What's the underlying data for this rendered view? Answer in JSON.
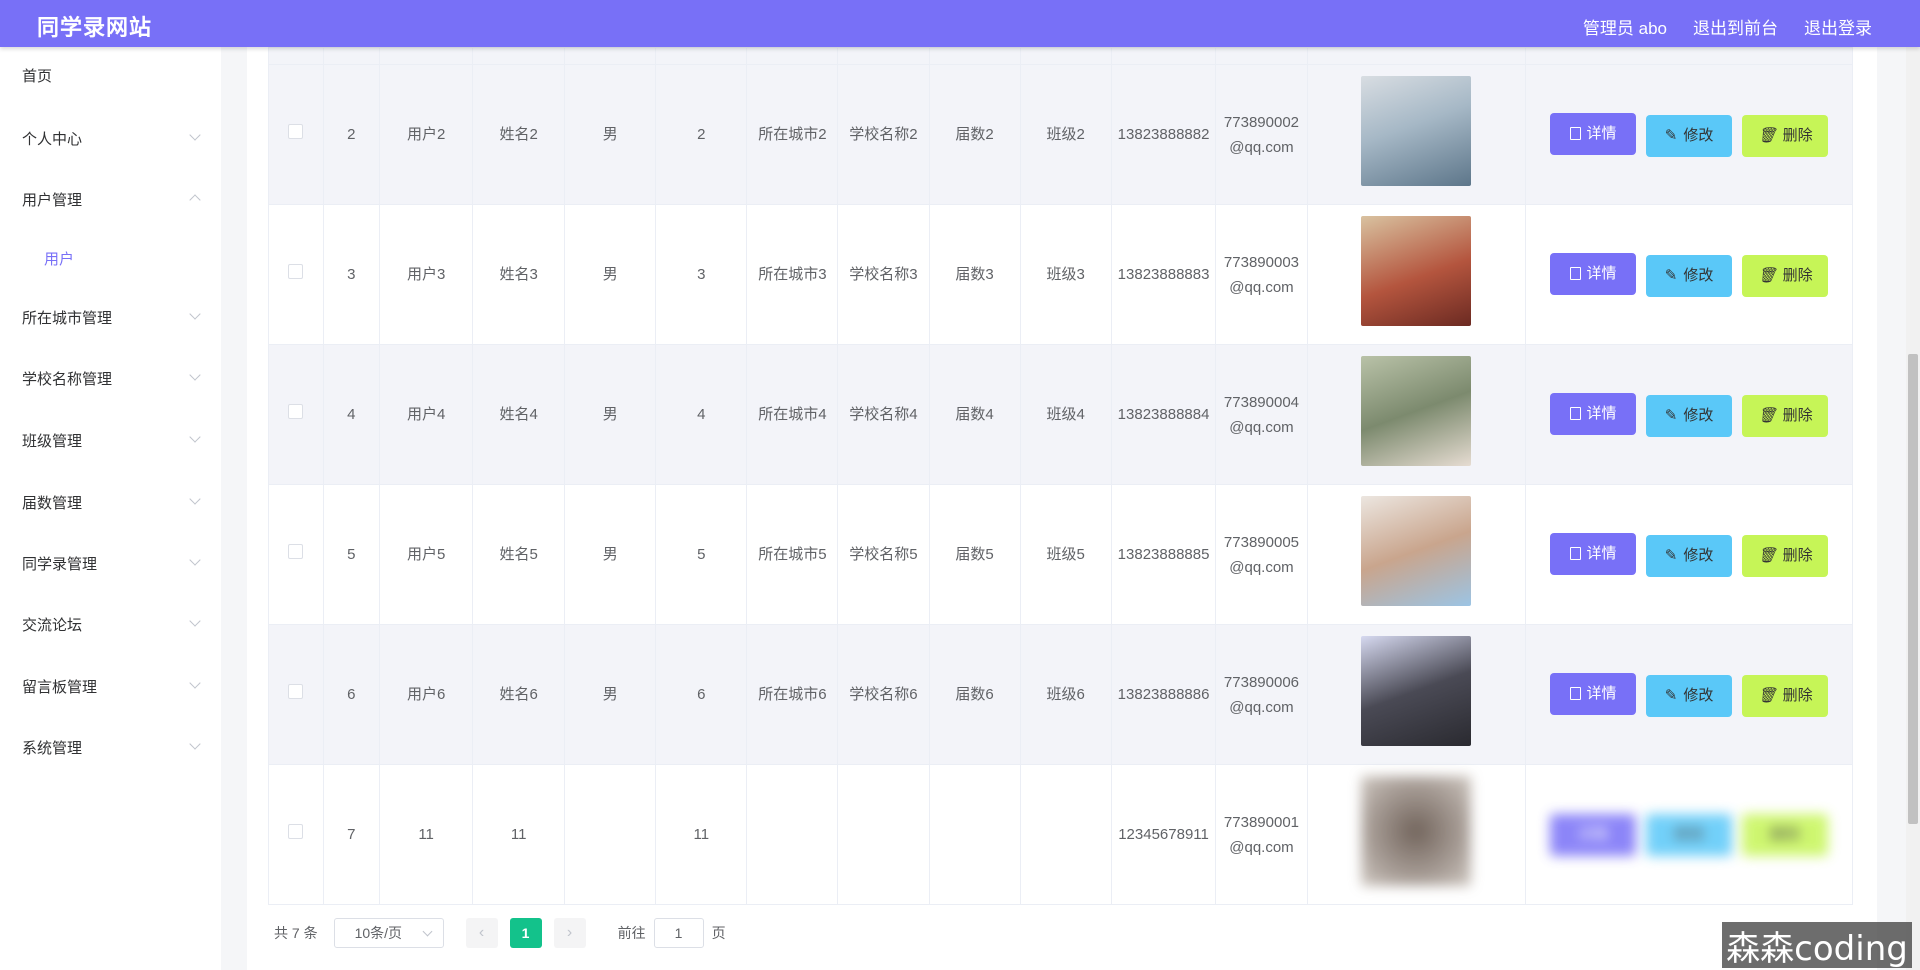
{
  "app": {
    "title": "同学录网站"
  },
  "header": {
    "admin": "管理员 abo",
    "to_front": "退出到前台",
    "logout": "退出登录"
  },
  "sidebar": {
    "items": [
      {
        "label": "首页",
        "arrow": ""
      },
      {
        "label": "个人中心",
        "arrow": "down"
      },
      {
        "label": "用户管理",
        "arrow": "up"
      },
      {
        "label": "用户",
        "arrow": ""
      },
      {
        "label": "所在城市管理",
        "arrow": "down"
      },
      {
        "label": "学校名称管理",
        "arrow": "down"
      },
      {
        "label": "班级管理",
        "arrow": "down"
      },
      {
        "label": "届数管理",
        "arrow": "down"
      },
      {
        "label": "同学录管理",
        "arrow": "down"
      },
      {
        "label": "交流论坛",
        "arrow": "down"
      },
      {
        "label": "留言板管理",
        "arrow": "down"
      },
      {
        "label": "系统管理",
        "arrow": "down"
      }
    ]
  },
  "table": {
    "rows": [
      {
        "idx": "2",
        "account": "用户2",
        "name": "姓名2",
        "gender": "男",
        "age": "2",
        "city": "所在城市2",
        "school": "学校名称2",
        "grade": "届数2",
        "class": "班级2",
        "phone": "13823888882",
        "email": "773890002@qq.com",
        "photo_color": "#8aa0b4"
      },
      {
        "idx": "3",
        "account": "用户3",
        "name": "姓名3",
        "gender": "男",
        "age": "3",
        "city": "所在城市3",
        "school": "学校名称3",
        "grade": "届数3",
        "class": "班级3",
        "phone": "13823888883",
        "email": "773890003@qq.com",
        "photo_color": "#b4553e"
      },
      {
        "idx": "4",
        "account": "用户4",
        "name": "姓名4",
        "gender": "男",
        "age": "4",
        "city": "所在城市4",
        "school": "学校名称4",
        "grade": "届数4",
        "class": "班级4",
        "phone": "13823888884",
        "email": "773890004@qq.com",
        "photo_color": "#7c8a6e"
      },
      {
        "idx": "5",
        "account": "用户5",
        "name": "姓名5",
        "gender": "男",
        "age": "5",
        "city": "所在城市5",
        "school": "学校名称5",
        "grade": "届数5",
        "class": "班级5",
        "phone": "13823888885",
        "email": "773890005@qq.com",
        "photo_color": "#c9a58d"
      },
      {
        "idx": "6",
        "account": "用户6",
        "name": "姓名6",
        "gender": "男",
        "age": "6",
        "city": "所在城市6",
        "school": "学校名称6",
        "grade": "届数6",
        "class": "班级6",
        "phone": "13823888886",
        "email": "773890006@qq.com",
        "photo_color": "#4a4a55"
      },
      {
        "idx": "7",
        "account": "11",
        "name": "11",
        "gender": "",
        "age": "11",
        "city": "",
        "school": "",
        "grade": "",
        "class": "",
        "phone": "12345678911",
        "email": "773890001@qq.com",
        "photo_color": "#9a8e86"
      }
    ],
    "actions": {
      "detail": "详情",
      "edit": "修改",
      "delete": "删除"
    }
  },
  "pagination": {
    "total": "共 7 条",
    "page_size": "10条/页",
    "current": "1",
    "goto_prefix": "前往",
    "goto_value": "1",
    "goto_suffix": "页",
    "prev": "‹",
    "next": "›"
  },
  "watermark": "森森coding"
}
